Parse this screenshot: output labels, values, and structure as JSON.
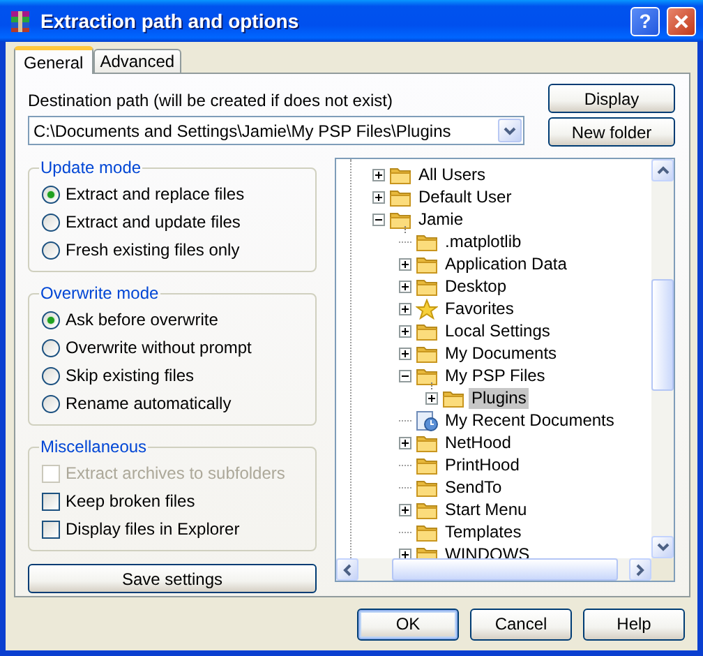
{
  "window": {
    "title": "Extraction path and options",
    "help_button": "?"
  },
  "tabs": [
    {
      "label": "General",
      "selected": true
    },
    {
      "label": "Advanced",
      "selected": false
    }
  ],
  "destination": {
    "label": "Destination path (will be created if does not exist)",
    "value": "C:\\Documents and Settings\\Jamie\\My PSP Files\\Plugins"
  },
  "side_buttons": [
    "Display",
    "New folder"
  ],
  "groups": [
    {
      "title": "Update mode",
      "kind": "radio",
      "options": [
        {
          "label": "Extract and replace files",
          "selected": true
        },
        {
          "label": "Extract and update files",
          "selected": false
        },
        {
          "label": "Fresh existing files only",
          "selected": false
        }
      ]
    },
    {
      "title": "Overwrite mode",
      "kind": "radio",
      "options": [
        {
          "label": "Ask before overwrite",
          "selected": true
        },
        {
          "label": "Overwrite without prompt",
          "selected": false
        },
        {
          "label": "Skip existing files",
          "selected": false
        },
        {
          "label": "Rename automatically",
          "selected": false
        }
      ]
    },
    {
      "title": "Miscellaneous",
      "kind": "checkbox",
      "options": [
        {
          "label": "Extract archives to subfolders",
          "checked": false,
          "disabled": true
        },
        {
          "label": "Keep broken files",
          "checked": false,
          "disabled": false
        },
        {
          "label": "Display files in Explorer",
          "checked": false,
          "disabled": false
        }
      ]
    }
  ],
  "save_button": "Save settings",
  "tree": [
    {
      "label": "All Users",
      "kind": "folder",
      "has_children": true,
      "expanded": false,
      "selected": false
    },
    {
      "label": "Default User",
      "kind": "folder",
      "has_children": true,
      "expanded": false,
      "selected": false
    },
    {
      "label": "Jamie",
      "kind": "folder",
      "has_children": true,
      "expanded": true,
      "selected": false,
      "children": [
        {
          "label": ".matplotlib",
          "kind": "folder",
          "has_children": false,
          "selected": false
        },
        {
          "label": "Application Data",
          "kind": "folder",
          "has_children": true,
          "expanded": false,
          "selected": false
        },
        {
          "label": "Desktop",
          "kind": "folder",
          "has_children": true,
          "expanded": false,
          "selected": false
        },
        {
          "label": "Favorites",
          "kind": "favorites",
          "has_children": true,
          "expanded": false,
          "selected": false
        },
        {
          "label": "Local Settings",
          "kind": "folder",
          "has_children": true,
          "expanded": false,
          "selected": false
        },
        {
          "label": "My Documents",
          "kind": "folder",
          "has_children": true,
          "expanded": false,
          "selected": false
        },
        {
          "label": "My PSP Files",
          "kind": "folder",
          "has_children": true,
          "expanded": true,
          "selected": false,
          "children": [
            {
              "label": "Plugins",
              "kind": "folder",
              "has_children": true,
              "expanded": false,
              "selected": true
            }
          ]
        },
        {
          "label": "My Recent Documents",
          "kind": "recent",
          "has_children": false,
          "selected": false
        },
        {
          "label": "NetHood",
          "kind": "folder",
          "has_children": true,
          "expanded": false,
          "selected": false
        },
        {
          "label": "PrintHood",
          "kind": "folder",
          "has_children": false,
          "selected": false
        },
        {
          "label": "SendTo",
          "kind": "folder",
          "has_children": false,
          "selected": false
        },
        {
          "label": "Start Menu",
          "kind": "folder",
          "has_children": true,
          "expanded": false,
          "selected": false
        },
        {
          "label": "Templates",
          "kind": "folder",
          "has_children": false,
          "selected": false
        },
        {
          "label": "WINDOWS",
          "kind": "folder",
          "has_children": true,
          "expanded": false,
          "selected": false
        }
      ]
    }
  ],
  "buttons": [
    {
      "label": "OK",
      "default": true
    },
    {
      "label": "Cancel",
      "default": false
    },
    {
      "label": "Help",
      "default": false
    }
  ]
}
